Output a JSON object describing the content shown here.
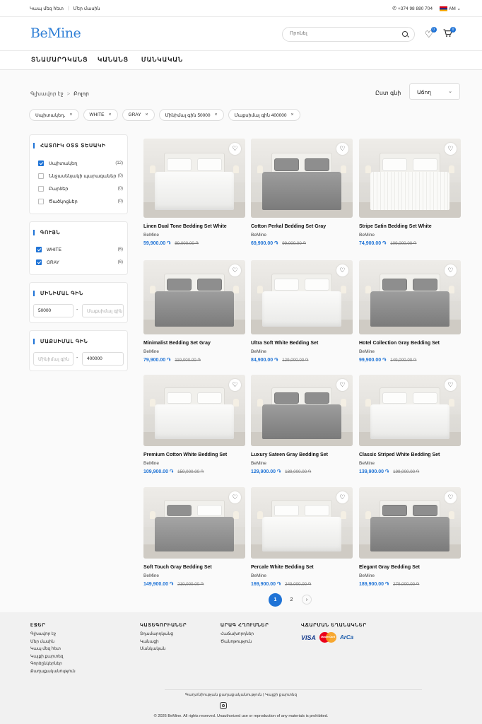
{
  "topbar": {
    "contact": "Կապ մեզ հետ",
    "about": "Մեր մասին",
    "phone": "+374 98 880 704",
    "lang": "AM"
  },
  "header": {
    "logo": "BeMine",
    "search_placeholder": "Որոնել",
    "wishlist_count": "0",
    "cart_count": "0"
  },
  "nav": {
    "items": [
      "ՏՆԱՄԱՐԴԿԱՆՑ",
      "ԿԱՆԱՆՑ",
      "ՄԱՆԿԱԿԱՆ"
    ]
  },
  "breadcrumb": {
    "home": "Գլխավոր էջ",
    "sep": ">",
    "current": "Բոլոր"
  },
  "sort": {
    "label": "Ըստ գնի",
    "value": "Աճող"
  },
  "chips": [
    "Սպիտակեղ․",
    "WHITE",
    "GRAY",
    "Մինիմալ գին 50000",
    "Մաքսիմալ գին 400000"
  ],
  "filters": {
    "categories": {
      "title": "ՀԱՏՈՒԿ ՕՏՏ ՏԵՍԱԿԻ",
      "items": [
        {
          "label": "Սպիտակեղ",
          "count": "(12)",
          "checked": true
        },
        {
          "label": "Ննջասենյակի պարագաներ",
          "count": "(0)",
          "checked": false
        },
        {
          "label": "Բարձեր",
          "count": "(0)",
          "checked": false
        },
        {
          "label": "Ծածկոցներ",
          "count": "(0)",
          "checked": false
        }
      ]
    },
    "colors": {
      "title": "ԳՈՒՅՆ",
      "items": [
        {
          "label": "WHITE",
          "count": "(6)",
          "checked": true
        },
        {
          "label": "GRAY",
          "count": "(6)",
          "checked": true
        }
      ]
    },
    "min_price": {
      "title": "ՄԻՆԻՄԱԼ ԳԻՆ",
      "from": "50000",
      "to_placeholder": "Մաքսիմալ գին"
    },
    "max_price": {
      "title": "ՄԱՔՍԻՄԱԼ ԳԻՆ",
      "from_placeholder": "Մինիմալ գին",
      "to": "400000"
    }
  },
  "products": [
    {
      "name": "Linen Dual Tone Bedding Set White",
      "brand": "BeMine",
      "price": "59,900.00 ֏",
      "old_price": "89,000.00 ֏",
      "style": "white"
    },
    {
      "name": "Cotton Perkal Bedding Set Gray",
      "brand": "BeMine",
      "price": "69,900.00 ֏",
      "old_price": "99,000.00 ֏",
      "style": "gray"
    },
    {
      "name": "Stripe Satin Bedding Set White",
      "brand": "BeMine",
      "price": "74,900.00 ֏",
      "old_price": "109,000.00 ֏",
      "style": "stripe"
    },
    {
      "name": "Minimalist Bedding Set Gray",
      "brand": "BeMine",
      "price": "79,900.00 ֏",
      "old_price": "119,000.00 ֏",
      "style": "gray"
    },
    {
      "name": "Ultra Soft White Bedding Set",
      "brand": "BeMine",
      "price": "84,900.00 ֏",
      "old_price": "129,000.00 ֏",
      "style": "white"
    },
    {
      "name": "Hotel Collection Gray Bedding Set",
      "brand": "BeMine",
      "price": "99,900.00 ֏",
      "old_price": "149,000.00 ֏",
      "style": "gray"
    },
    {
      "name": "Premium Cotton White Bedding Set",
      "brand": "BeMine",
      "price": "109,900.00 ֏",
      "old_price": "159,000.00 ֏",
      "style": "white"
    },
    {
      "name": "Luxury Sateen Gray Bedding Set",
      "brand": "BeMine",
      "price": "129,900.00 ֏",
      "old_price": "189,000.00 ֏",
      "style": "gray"
    },
    {
      "name": "Classic Striped White Bedding Set",
      "brand": "BeMine",
      "price": "139,900.00 ֏",
      "old_price": "199,000.00 ֏",
      "style": "white"
    },
    {
      "name": "Soft Touch Gray Bedding Set",
      "brand": "BeMine",
      "price": "149,900.00 ֏",
      "old_price": "219,000.00 ֏",
      "style": "mixed"
    },
    {
      "name": "Percale White Bedding Set",
      "brand": "BeMine",
      "price": "169,900.00 ֏",
      "old_price": "249,000.00 ֏",
      "style": "white"
    },
    {
      "name": "Elegant Gray Bedding Set",
      "brand": "BeMine",
      "price": "189,900.00 ֏",
      "old_price": "279,000.00 ֏",
      "style": "gray"
    }
  ],
  "pagination": {
    "pages": [
      "1",
      "2"
    ],
    "active": "1",
    "next": "›"
  },
  "footer": {
    "pages": {
      "title": "ԷՋԵՐ",
      "links": [
        "Գլխավոր էջ",
        "Մեր մասին",
        "Կապ մեզ հետ",
        "Կայքի քարտեզ",
        "Գործընկերներ",
        "Քաղաքականություն"
      ]
    },
    "categories": {
      "title": "ԿԱՏԵԳՈՐԻԱՆԵՐ",
      "links": [
        "Տղամարդկանց",
        "Կանացի",
        "Մանկական"
      ]
    },
    "quick": {
      "title": "ԱՐԱԳ ՀՂՈՒՄՆԵՐ",
      "links": [
        "Հաճախորդներ",
        "Ծանոթություն"
      ]
    },
    "payment": {
      "title": "ՎՃԱՐՄԱՆ ԵՂԱՆԱԿՆԵՐ",
      "visa": "VISA",
      "mastercard": "MasterCard",
      "arca": "ArCa"
    },
    "legal": "Գաղտնիության քաղաքականություն   |   Կայքի քարտեզ",
    "copyright": "© 2026 BeMine. All rights reserved. Unauthorized use or reproduction of any materials is prohibited."
  }
}
